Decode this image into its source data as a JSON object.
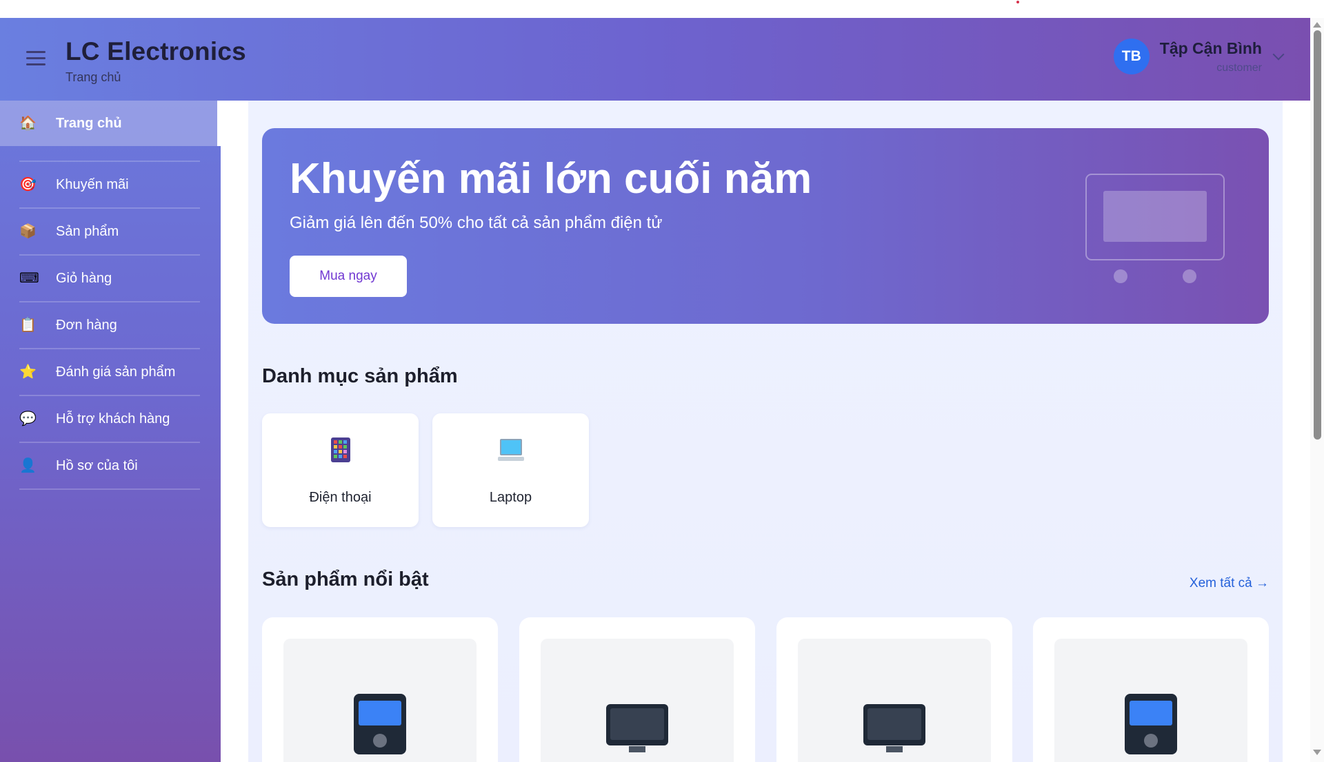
{
  "app": {
    "title": "LC Electronics",
    "subtitle": "Trang chủ"
  },
  "user": {
    "initials": "TB",
    "name": "Tập Cận Bình",
    "role": "customer"
  },
  "sidebar": {
    "items": [
      {
        "label": "Trang chủ",
        "icon": "house-icon",
        "active": true
      },
      {
        "label": "Khuyến mãi",
        "icon": "target-icon",
        "active": false
      },
      {
        "label": "Sản phẩm",
        "icon": "package-icon",
        "active": false
      },
      {
        "label": "Giỏ hàng",
        "icon": "keyboard-icon",
        "active": false
      },
      {
        "label": "Đơn hàng",
        "icon": "clipboard-icon",
        "active": false
      },
      {
        "label": "Đánh giá sản phẩm",
        "icon": "star-icon",
        "active": false
      },
      {
        "label": "Hỗ trợ khách hàng",
        "icon": "speech-bubble-icon",
        "active": false
      },
      {
        "label": "Hồ sơ của tôi",
        "icon": "user-icon",
        "active": false
      }
    ]
  },
  "hero": {
    "title": "Khuyến mãi lớn cuối năm",
    "subtitle": "Giảm giá lên đến 50% cho tất cả sản phẩm điện tử",
    "button": "Mua ngay"
  },
  "categories": {
    "title": "Danh mục sản phẩm",
    "items": [
      {
        "label": "Điện thoại",
        "icon": "phone-icon"
      },
      {
        "label": "Laptop",
        "icon": "laptop-icon"
      }
    ]
  },
  "featured": {
    "title": "Sản phẩm nổi bật",
    "see_all": "Xem tất cả →",
    "products": [
      {
        "icon": "phone-icon"
      },
      {
        "icon": "monitor-icon"
      },
      {
        "icon": "monitor-icon"
      },
      {
        "icon": "phone-icon"
      }
    ]
  },
  "colors": {
    "accent": "#6d63cf",
    "avatar": "#2f6ff0",
    "button_text": "#7138d2",
    "link": "#2461da"
  }
}
